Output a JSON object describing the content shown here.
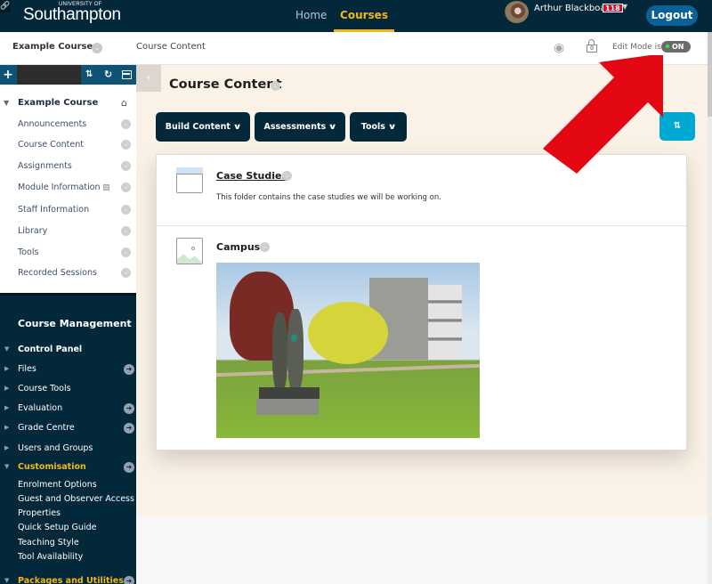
{
  "header": {
    "logo_small": "UNIVERSITY OF",
    "logo_name": "Southampton",
    "nav": [
      {
        "label": "Home",
        "active": false
      },
      {
        "label": "Courses",
        "active": true
      }
    ],
    "user_name": "Arthur Blackboard",
    "notification_count": "118",
    "logout_label": "Logout",
    "accent_color": "#f2b718",
    "brand_color": "#03283a"
  },
  "breadcrumb": {
    "course": "Example Course",
    "page": "Course Content",
    "edit_mode_label": "Edit Mode is:",
    "edit_mode_value": "ON",
    "lock_count": "0"
  },
  "sidebar": {
    "course_title": "Example Course",
    "items": [
      {
        "label": "Announcements"
      },
      {
        "label": "Course Content"
      },
      {
        "label": "Assignments"
      },
      {
        "label": "Module Information"
      },
      {
        "label": "Staff Information"
      },
      {
        "label": "Library"
      },
      {
        "label": "Tools"
      },
      {
        "label": "Recorded Sessions"
      }
    ],
    "management": {
      "title": "Course Management",
      "control_panel": "Control Panel",
      "rows": [
        {
          "label": "Files",
          "has_go": true
        },
        {
          "label": "Course Tools",
          "has_go": false
        },
        {
          "label": "Evaluation",
          "has_go": true
        },
        {
          "label": "Grade Centre",
          "has_go": true
        },
        {
          "label": "Users and Groups",
          "has_go": false
        }
      ],
      "customisation": {
        "label": "Customisation",
        "items": [
          "Enrolment Options",
          "Guest and Observer Access",
          "Properties",
          "Quick Setup Guide",
          "Teaching Style",
          "Tool Availability"
        ]
      },
      "packages": "Packages and Utilities"
    }
  },
  "main": {
    "title": "Course Content",
    "actions": [
      {
        "label": "Build Content"
      },
      {
        "label": "Assessments"
      },
      {
        "label": "Tools"
      }
    ],
    "items": [
      {
        "type": "folder",
        "title": "Case Studies",
        "description": "This folder contains the case studies we will be working on."
      },
      {
        "type": "image",
        "title": "Campus"
      }
    ]
  }
}
